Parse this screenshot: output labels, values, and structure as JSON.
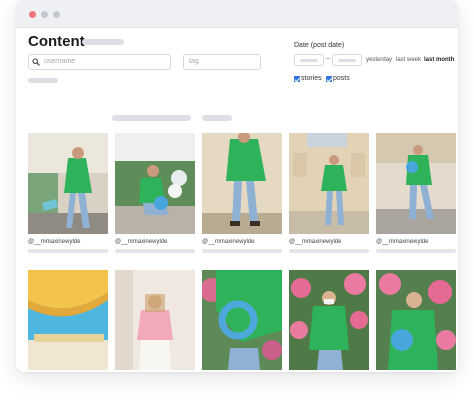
{
  "window": {
    "traffic_lights": [
      "close",
      "minimize",
      "maximize"
    ]
  },
  "header": {
    "title": "Content"
  },
  "filters": {
    "search_placeholder": "username",
    "tag_placeholder": "tag",
    "date_label": "Date (post date)",
    "date_separator": "–",
    "quick_ranges": [
      "yesterday",
      "last week",
      "last month"
    ],
    "active_range": "last month",
    "checkboxes": [
      {
        "label": "stories",
        "checked": true
      },
      {
        "label": "posts",
        "checked": true
      }
    ]
  },
  "grid": {
    "items": [
      {
        "handle": "@__mmaxinewylde",
        "photo": "green-jacket-street-wall"
      },
      {
        "handle": "@__mmaxinewylde",
        "photo": "green-jacket-crouching-hydrangeas"
      },
      {
        "handle": "@__mmaxinewylde",
        "photo": "green-jacket-beige-wall"
      },
      {
        "handle": "@__mmaxinewylde",
        "photo": "green-jacket-building-front"
      },
      {
        "handle": "@__mmaxinewylde",
        "photo": "green-jacket-blue-bag-walking"
      },
      {
        "handle": "",
        "photo": "yellow-umbrella-beach"
      },
      {
        "handle": "",
        "photo": "pink-top-studio"
      },
      {
        "handle": "",
        "photo": "blue-bag-green-sleeve-closeup"
      },
      {
        "handle": "",
        "photo": "green-jacket-pink-flowers"
      },
      {
        "handle": "",
        "photo": "green-jacket-pink-flowers-2"
      }
    ]
  },
  "colors": {
    "accent_red": "#f0737a",
    "checkbox_blue": "#2f74e0",
    "skeleton_gray": "#dcdfe4"
  }
}
